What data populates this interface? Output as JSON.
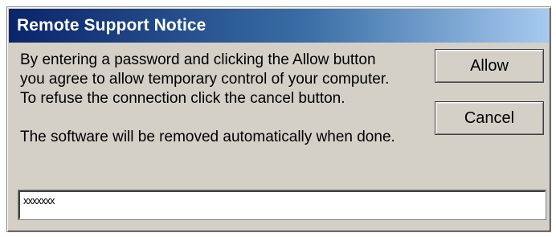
{
  "window": {
    "title": "Remote Support Notice"
  },
  "message": {
    "lines": [
      "By entering a password and clicking the Allow button",
      "you agree to allow temporary control of your computer.",
      "To refuse the connection click the cancel button."
    ],
    "footer": "The software will be removed automatically when done."
  },
  "buttons": {
    "allow_label": "Allow",
    "cancel_label": "Cancel"
  },
  "password": {
    "value": "xxxxxxx"
  },
  "colors": {
    "title_bar_start": "#0a246a",
    "title_bar_end": "#a6caf0",
    "dialog_face": "#d4d0c8"
  }
}
